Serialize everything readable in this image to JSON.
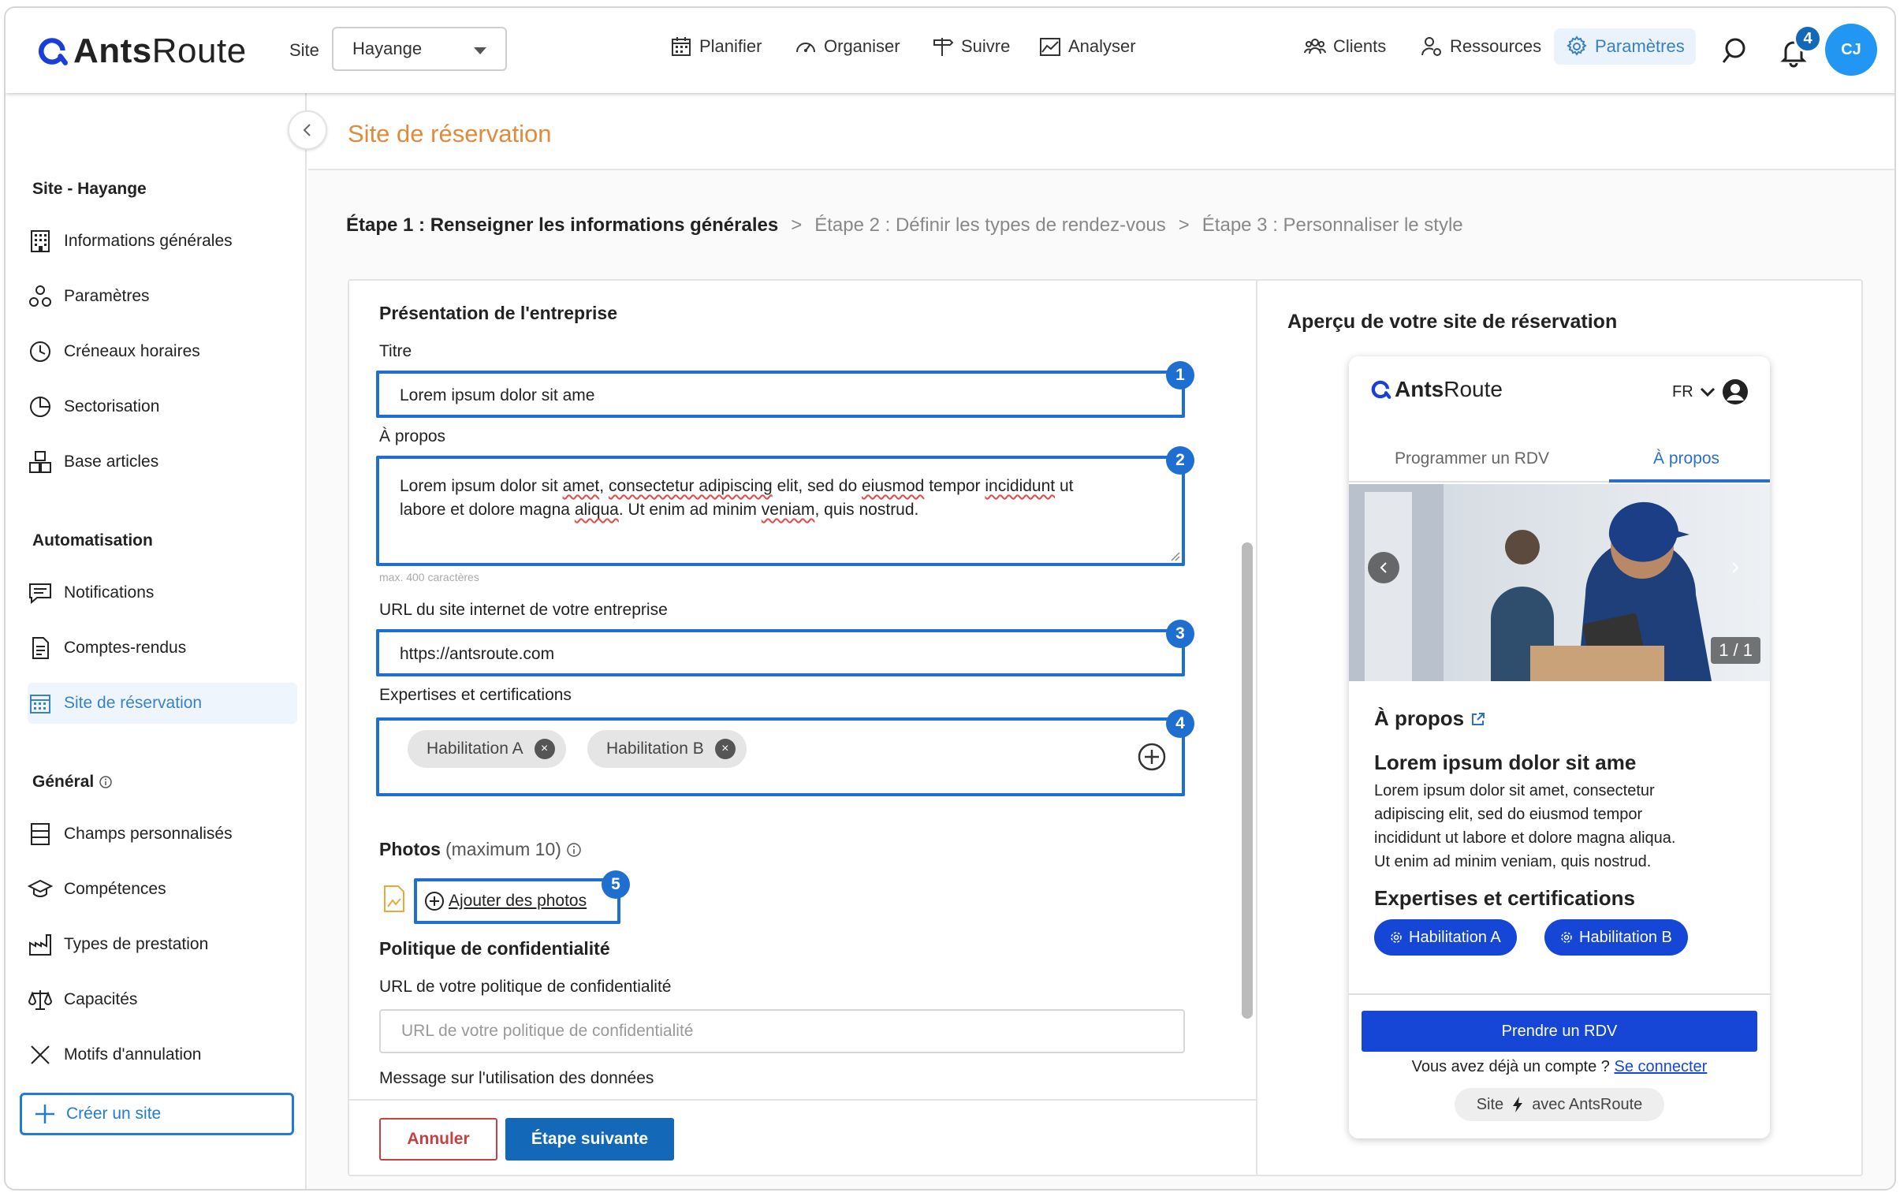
{
  "app": {
    "name_bold": "Ants",
    "name_rest": "Route"
  },
  "header": {
    "site_label": "Site",
    "site_value": "Hayange",
    "nav": [
      "Planifier",
      "Organiser",
      "Suivre",
      "Analyser"
    ],
    "right": [
      "Clients",
      "Ressources",
      "Paramètres"
    ],
    "notif_count": "4",
    "avatar_initials": "CJ"
  },
  "sidebar": {
    "section1": "Site - Hayange",
    "items1": [
      "Informations générales",
      "Paramètres",
      "Créneaux horaires",
      "Sectorisation",
      "Base articles"
    ],
    "section2": "Automatisation",
    "items2": [
      "Notifications",
      "Comptes-rendus",
      "Site de réservation"
    ],
    "section3": "Général",
    "items3": [
      "Champs personnalisés",
      "Compétences",
      "Types de prestation",
      "Capacités",
      "Motifs d'annulation"
    ],
    "create_label": "Créer un site"
  },
  "page": {
    "title": "Site de réservation",
    "steps": {
      "step1": "Étape 1 : Renseigner les informations générales",
      "sep": ">",
      "step2": "Étape 2 : Définir les types de rendez-vous",
      "step3": "Étape 3 : Personnaliser le style"
    }
  },
  "form": {
    "section": "Présentation de l'entreprise",
    "title_label": "Titre",
    "title_value": "Lorem ipsum dolor sit ame",
    "about_label": "À propos",
    "about_value_1a": "Lorem ipsum dolor sit ",
    "about_value_1b": "amet",
    "about_value_1c": ", ",
    "about_value_1d": "consectetur adipiscing",
    "about_value_1e": " elit, sed do ",
    "about_value_1f": "eiusmod",
    "about_value_1g": " tempor ",
    "about_value_1h": "incididunt",
    "about_value_1i": " ut",
    "about_value_2a": "labore et dolore magna ",
    "about_value_2b": "aliqua",
    "about_value_2c": ". Ut enim ad minim ",
    "about_value_2d": "veniam",
    "about_value_2e": ", quis nostrud.",
    "about_hint": "max. 400 caractères",
    "url_label": "URL du site internet de votre entreprise",
    "url_value": "https://antsroute.com",
    "expertise_label": "Expertises et certifications",
    "chips": [
      "Habilitation A",
      "Habilitation B"
    ],
    "chip_remove": "×",
    "photos_label": "Photos",
    "photos_hint": "(maximum 10)",
    "add_photos": "Ajouter des photos",
    "privacy_section": "Politique de confidentialité",
    "privacy_label": "URL de votre politique de confidentialité",
    "privacy_placeholder": "URL de votre politique de confidentialité",
    "data_msg_label": "Message sur l'utilisation des données",
    "markers": [
      "1",
      "2",
      "3",
      "4",
      "5"
    ],
    "cancel": "Annuler",
    "next": "Étape suivante"
  },
  "preview": {
    "title": "Aperçu de votre site de réservation",
    "lang": "FR",
    "tab_book": "Programmer un RDV",
    "tab_about": "À propos",
    "photo_counter": "1 / 1",
    "about_heading": "À propos",
    "company_title": "Lorem ipsum dolor sit ame",
    "about_lines": [
      "Lorem ipsum dolor sit amet, consectetur",
      "adipiscing elit, sed do eiusmod tempor",
      "incididunt ut labore et dolore magna aliqua.",
      "Ut enim ad minim veniam, quis nostrud."
    ],
    "expertise_heading": "Expertises et certifications",
    "chips": [
      "Habilitation A",
      "Habilitation B"
    ],
    "book_button": "Prendre un RDV",
    "login_text": "Vous avez déjà un compte ?",
    "login_link": "Se connecter",
    "powered_site": "Site",
    "powered_by": "avec AntsRoute"
  },
  "colors": {
    "accent": "#1f6fd1",
    "title_orange": "#e08a3c",
    "primary_btn": "#1468b8",
    "preview_blue": "#1546d6"
  }
}
